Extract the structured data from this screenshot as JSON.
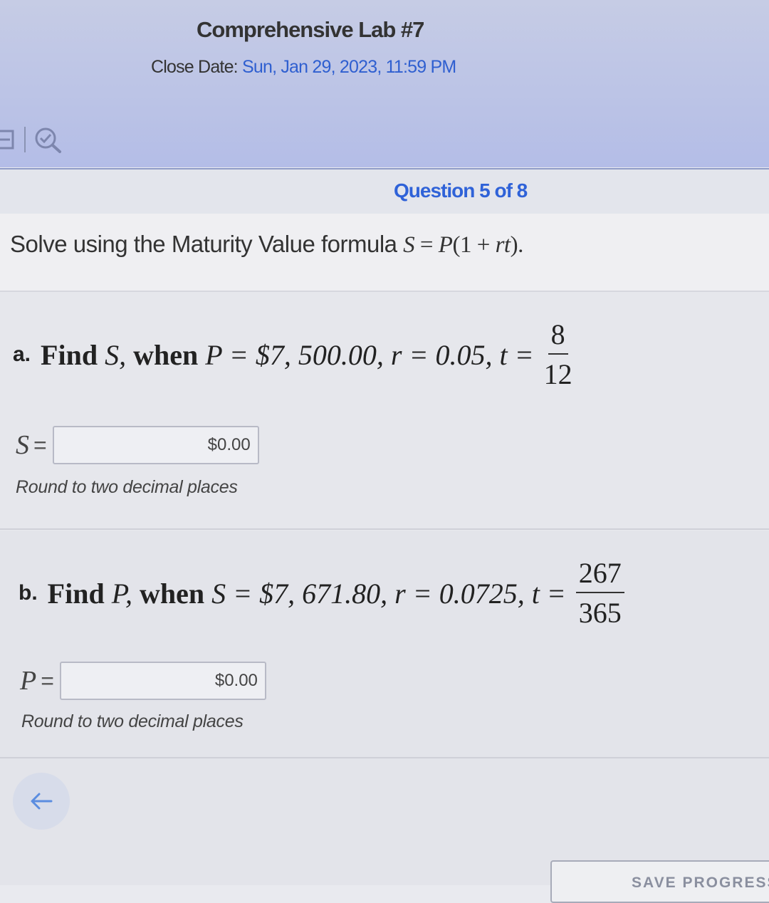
{
  "header": {
    "title": "Comprehensive Lab #7",
    "close_label": "Close Date:",
    "close_date": "Sun, Jan 29, 2023, 11:59 PM"
  },
  "toolbar": {
    "icons": [
      "page-icon",
      "search-check-icon"
    ]
  },
  "question": {
    "title": "Question 5 of 8"
  },
  "intro": {
    "text": "Solve using the Maturity Value formula",
    "formula_lhs": "S",
    "formula_eq": " = ",
    "formula_p": "P",
    "formula_paren_open": "(1 + ",
    "formula_rt": "rt",
    "formula_paren_close": ")."
  },
  "part_a": {
    "label": "a.",
    "find": "Find",
    "var": "S,",
    "when": "when",
    "condition": "P = $7, 500.00, r = 0.05, t =",
    "t_num": "8",
    "t_den": "12",
    "answer_var": "S",
    "answer_eq": "=",
    "answer_value": "$0.00",
    "hint": "Round to two decimal places"
  },
  "part_b": {
    "label": "b.",
    "find": "Find",
    "var": "P,",
    "when": "when",
    "condition": "S = $7, 671.80, r = 0.0725, t =",
    "t_num": "267",
    "t_den": "365",
    "answer_var": "P",
    "answer_eq": "=",
    "answer_value": "$0.00",
    "hint": "Round to two decimal places"
  },
  "footer": {
    "back_icon": "arrow-left-icon",
    "save_label": "SAVE PROGRESS"
  },
  "colors": {
    "accent": "#2f62d8",
    "header_bg": "#bcc4e6"
  }
}
